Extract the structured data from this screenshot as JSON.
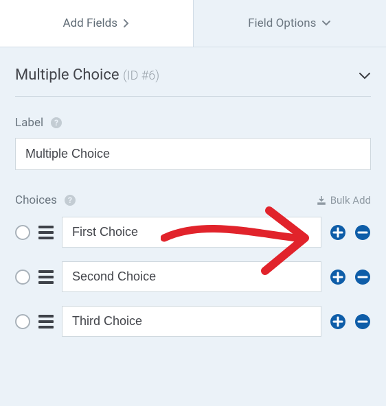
{
  "tabs": {
    "add_fields": "Add Fields",
    "field_options": "Field Options"
  },
  "panel": {
    "title": "Multiple Choice",
    "id_label": "(ID #6)"
  },
  "label_section": {
    "label": "Label",
    "value": "Multiple Choice"
  },
  "choices_section": {
    "label": "Choices",
    "bulk_add": "Bulk Add",
    "items": [
      {
        "value": "First Choice"
      },
      {
        "value": "Second Choice"
      },
      {
        "value": "Third Choice"
      }
    ]
  }
}
